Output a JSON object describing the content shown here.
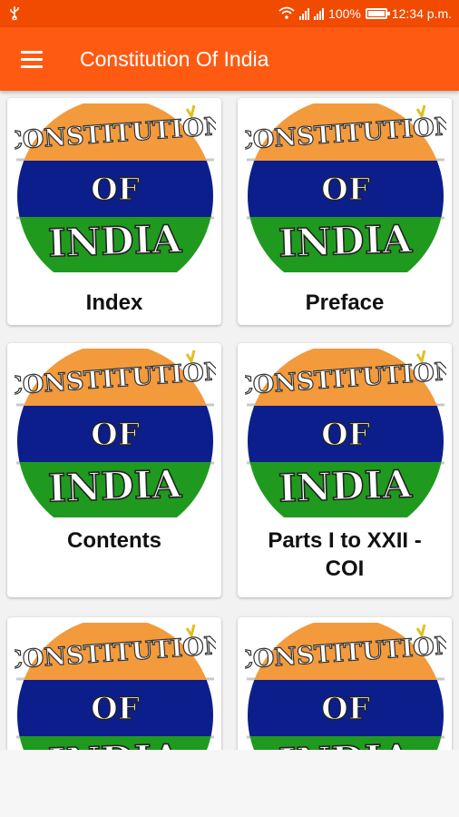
{
  "status_bar": {
    "usb_icon": "usb-icon",
    "wifi_icon": "wifi-icon",
    "battery_percent": "100%",
    "time": "12:34 p.m."
  },
  "app_bar": {
    "menu_icon": "hamburger-menu-icon",
    "title": "Constitution Of India"
  },
  "logo": {
    "line1": "CONSTITUTION",
    "line2": "OF",
    "line3": "INDIA",
    "colors": {
      "saffron": "#f39a3c",
      "blue": "#0c1e8c",
      "green": "#1f9a1f"
    }
  },
  "cards": [
    {
      "label": "Index"
    },
    {
      "label": "Preface"
    },
    {
      "label": "Contents"
    },
    {
      "label": "Parts I to XXII - COI"
    },
    {
      "label": ""
    },
    {
      "label": ""
    }
  ],
  "colors": {
    "status_bar": "#f04b00",
    "app_bar": "#ff5a12"
  }
}
